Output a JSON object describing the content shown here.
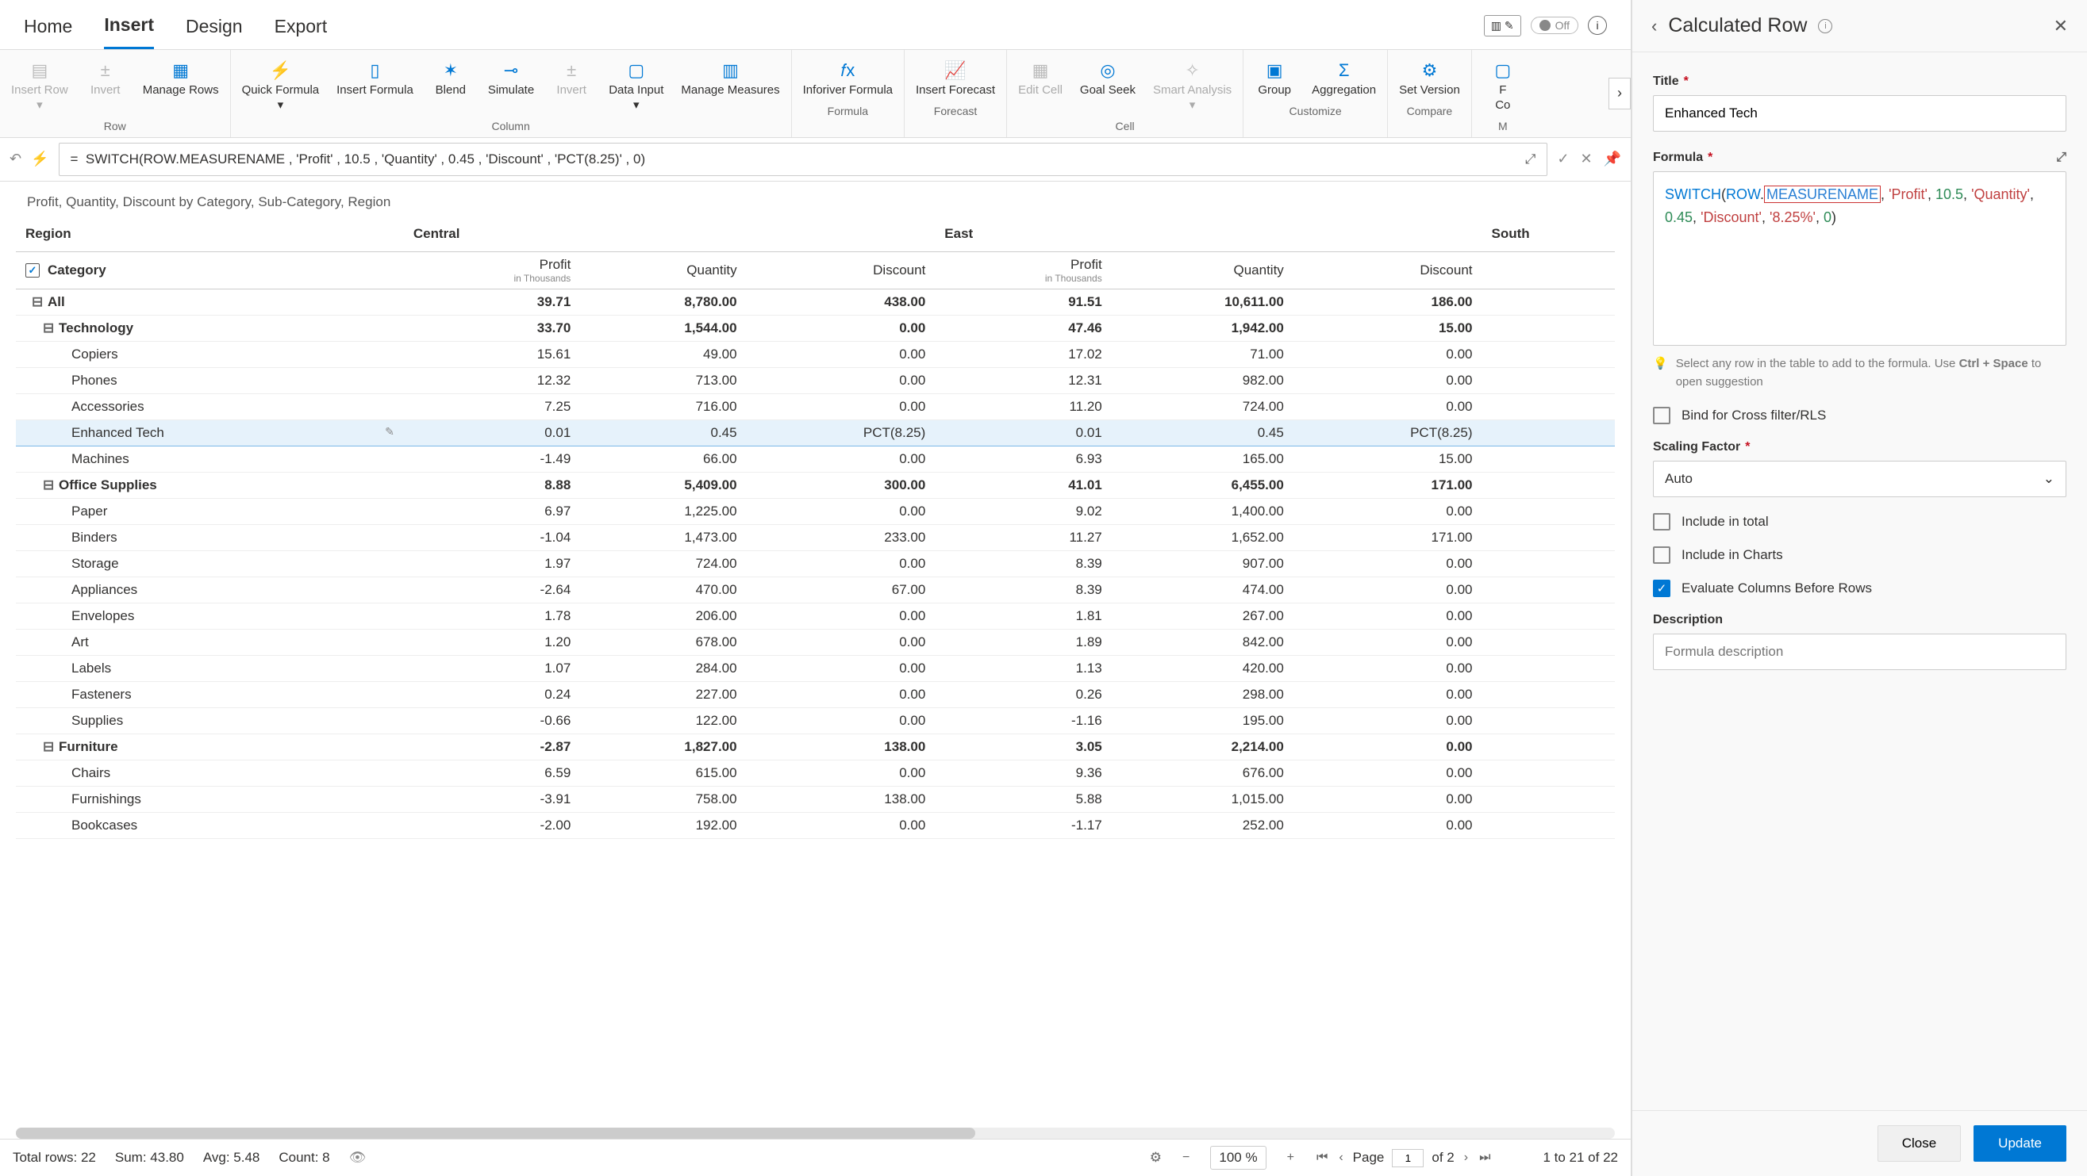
{
  "tabs": {
    "home": "Home",
    "insert": "Insert",
    "design": "Design",
    "export": "Export",
    "offLabel": "Off"
  },
  "ribbon": {
    "row": {
      "label": "Row",
      "insertRow": "Insert Row",
      "invert": "Invert",
      "manageRows": "Manage Rows"
    },
    "column": {
      "label": "Column",
      "quickFormula": "Quick Formula",
      "insertFormula": "Insert Formula",
      "blend": "Blend",
      "simulate": "Simulate",
      "invert": "Invert",
      "dataInput": "Data Input",
      "manageMeasures": "Manage Measures"
    },
    "formula": {
      "label": "Formula",
      "inforiver": "Inforiver Formula"
    },
    "forecast": {
      "label": "Forecast",
      "insertForecast": "Insert Forecast"
    },
    "cell": {
      "label": "Cell",
      "editCell": "Edit Cell",
      "goalSeek": "Goal Seek",
      "smartAnalysis": "Smart Analysis"
    },
    "customize": {
      "label": "Customize",
      "group": "Group",
      "aggregation": "Aggregation"
    },
    "compare": {
      "label": "Compare",
      "setVersion": "Set Version"
    },
    "more": {
      "f": "F",
      "co": "Co",
      "m": "M"
    }
  },
  "formulaBar": {
    "eq": "=",
    "text": "SWITCH(ROW.MEASURENAME , 'Profit' , 10.5 , 'Quantity' , 0.45 , 'Discount' , 'PCT(8.25)' , 0)"
  },
  "crumb": "Profit, Quantity, Discount by Category, Sub-Category, Region",
  "table": {
    "regionLabel": "Region",
    "categoryLabel": "Category",
    "regions": [
      "Central",
      "East",
      "South"
    ],
    "measures": [
      {
        "name": "Profit",
        "sub": "in Thousands"
      },
      {
        "name": "Quantity",
        "sub": ""
      },
      {
        "name": "Discount",
        "sub": ""
      }
    ],
    "rows": [
      {
        "lvl": 0,
        "label": "All",
        "bold": true,
        "v": [
          "39.71",
          "8,780.00",
          "438.00",
          "91.51",
          "10,611.00",
          "186.00"
        ]
      },
      {
        "lvl": 1,
        "label": "Technology",
        "bold": true,
        "v": [
          "33.70",
          "1,544.00",
          "0.00",
          "47.46",
          "1,942.00",
          "15.00"
        ]
      },
      {
        "lvl": 2,
        "label": "Copiers",
        "v": [
          "15.61",
          "49.00",
          "0.00",
          "17.02",
          "71.00",
          "0.00"
        ]
      },
      {
        "lvl": 2,
        "label": "Phones",
        "v": [
          "12.32",
          "713.00",
          "0.00",
          "12.31",
          "982.00",
          "0.00"
        ]
      },
      {
        "lvl": 2,
        "label": "Accessories",
        "v": [
          "7.25",
          "716.00",
          "0.00",
          "11.20",
          "724.00",
          "0.00"
        ]
      },
      {
        "lvl": 2,
        "label": "Enhanced Tech",
        "hl": true,
        "v": [
          "0.01",
          "0.45",
          "PCT(8.25)",
          "0.01",
          "0.45",
          "PCT(8.25)"
        ]
      },
      {
        "lvl": 2,
        "label": "Machines",
        "v": [
          "-1.49",
          "66.00",
          "0.00",
          "6.93",
          "165.00",
          "15.00"
        ]
      },
      {
        "lvl": 1,
        "label": "Office Supplies",
        "bold": true,
        "v": [
          "8.88",
          "5,409.00",
          "300.00",
          "41.01",
          "6,455.00",
          "171.00"
        ]
      },
      {
        "lvl": 2,
        "label": "Paper",
        "v": [
          "6.97",
          "1,225.00",
          "0.00",
          "9.02",
          "1,400.00",
          "0.00"
        ]
      },
      {
        "lvl": 2,
        "label": "Binders",
        "v": [
          "-1.04",
          "1,473.00",
          "233.00",
          "11.27",
          "1,652.00",
          "171.00"
        ]
      },
      {
        "lvl": 2,
        "label": "Storage",
        "v": [
          "1.97",
          "724.00",
          "0.00",
          "8.39",
          "907.00",
          "0.00"
        ]
      },
      {
        "lvl": 2,
        "label": "Appliances",
        "v": [
          "-2.64",
          "470.00",
          "67.00",
          "8.39",
          "474.00",
          "0.00"
        ]
      },
      {
        "lvl": 2,
        "label": "Envelopes",
        "v": [
          "1.78",
          "206.00",
          "0.00",
          "1.81",
          "267.00",
          "0.00"
        ]
      },
      {
        "lvl": 2,
        "label": "Art",
        "v": [
          "1.20",
          "678.00",
          "0.00",
          "1.89",
          "842.00",
          "0.00"
        ]
      },
      {
        "lvl": 2,
        "label": "Labels",
        "v": [
          "1.07",
          "284.00",
          "0.00",
          "1.13",
          "420.00",
          "0.00"
        ]
      },
      {
        "lvl": 2,
        "label": "Fasteners",
        "v": [
          "0.24",
          "227.00",
          "0.00",
          "0.26",
          "298.00",
          "0.00"
        ]
      },
      {
        "lvl": 2,
        "label": "Supplies",
        "v": [
          "-0.66",
          "122.00",
          "0.00",
          "-1.16",
          "195.00",
          "0.00"
        ]
      },
      {
        "lvl": 1,
        "label": "Furniture",
        "bold": true,
        "v": [
          "-2.87",
          "1,827.00",
          "138.00",
          "3.05",
          "2,214.00",
          "0.00"
        ]
      },
      {
        "lvl": 2,
        "label": "Chairs",
        "v": [
          "6.59",
          "615.00",
          "0.00",
          "9.36",
          "676.00",
          "0.00"
        ]
      },
      {
        "lvl": 2,
        "label": "Furnishings",
        "v": [
          "-3.91",
          "758.00",
          "138.00",
          "5.88",
          "1,015.00",
          "0.00"
        ]
      },
      {
        "lvl": 2,
        "label": "Bookcases",
        "v": [
          "-2.00",
          "192.00",
          "0.00",
          "-1.17",
          "252.00",
          "0.00"
        ]
      }
    ]
  },
  "status": {
    "totalRows": "Total rows: 22",
    "sum": "Sum: 43.80",
    "avg": "Avg: 5.48",
    "count": "Count: 8",
    "zoom": "100 %",
    "pageLabel": "Page",
    "pageNum": "1",
    "pageOf": "of 2",
    "range": "1 to 21 of 22"
  },
  "panel": {
    "title": "Calculated Row",
    "titleField": {
      "label": "Title",
      "value": "Enhanced Tech"
    },
    "formulaLabel": "Formula",
    "formulaParts": {
      "fn": "SWITCH",
      "open": "(",
      "row": "ROW",
      "dot": ".",
      "meas": "MEASURENAME",
      "c1": ",",
      "s1": "'Profit'",
      "c2": ",",
      "n1": "10.5",
      "c3": ",",
      "s2": "'Quantity'",
      "c4": ",",
      "n2": "0.45",
      "c5": ",",
      "s3": "'Discount'",
      "c6": ",",
      "s4": "'8.25%'",
      "c7": ",",
      "n3": "0",
      "close": ")"
    },
    "hint1": "Select any row in the table to add to the formula. Use ",
    "hintBold": "Ctrl + Space",
    "hint2": " to open suggestion",
    "bindCross": "Bind for Cross filter/RLS",
    "scalingLabel": "Scaling Factor",
    "scalingValue": "Auto",
    "includeTotal": "Include in total",
    "includeCharts": "Include in Charts",
    "evalCols": "Evaluate Columns Before Rows",
    "descLabel": "Description",
    "descPh": "Formula description",
    "close": "Close",
    "update": "Update"
  }
}
